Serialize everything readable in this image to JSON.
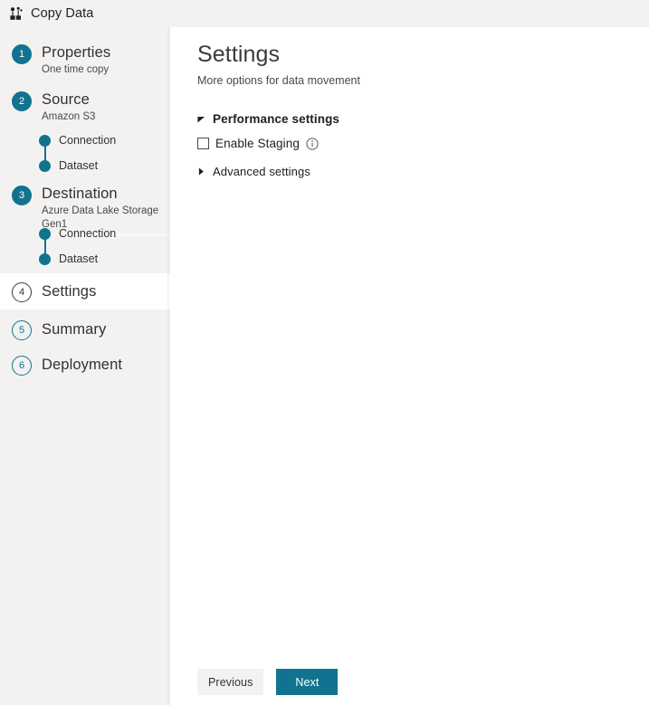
{
  "window": {
    "title": "Copy Data",
    "icon": "copy-data-icon"
  },
  "colors": {
    "accent": "#11738f",
    "sidebar_bg": "#f3f2f1",
    "panel_bg": "#ffffff",
    "text": "#323130"
  },
  "sidebar": {
    "steps": [
      {
        "number": "1",
        "label": "Properties",
        "sublabel": "One time copy",
        "state": "completed",
        "substeps": []
      },
      {
        "number": "2",
        "label": "Source",
        "sublabel": "Amazon S3",
        "state": "completed",
        "substeps": [
          {
            "label": "Connection"
          },
          {
            "label": "Dataset"
          }
        ]
      },
      {
        "number": "3",
        "label": "Destination",
        "sublabel": "Azure Data Lake Storage Gen1",
        "state": "completed",
        "substeps": [
          {
            "label": "Connection"
          },
          {
            "label": "Dataset"
          }
        ]
      },
      {
        "number": "4",
        "label": "Settings",
        "sublabel": "",
        "state": "selected",
        "substeps": []
      },
      {
        "number": "5",
        "label": "Summary",
        "sublabel": "",
        "state": "upcoming",
        "substeps": []
      },
      {
        "number": "6",
        "label": "Deployment",
        "sublabel": "",
        "state": "upcoming",
        "substeps": []
      }
    ]
  },
  "main": {
    "title": "Settings",
    "subtitle": "More options for data movement",
    "performance_section": {
      "title": "Performance settings",
      "expanded": true,
      "expand_icon": "triangle-down-icon",
      "enable_staging": {
        "label": "Enable Staging",
        "checked": false,
        "info_icon": "info-icon"
      }
    },
    "advanced_section": {
      "title": "Advanced settings",
      "expanded": false,
      "expand_icon": "triangle-right-icon"
    }
  },
  "footer": {
    "previous_label": "Previous",
    "next_label": "Next"
  }
}
